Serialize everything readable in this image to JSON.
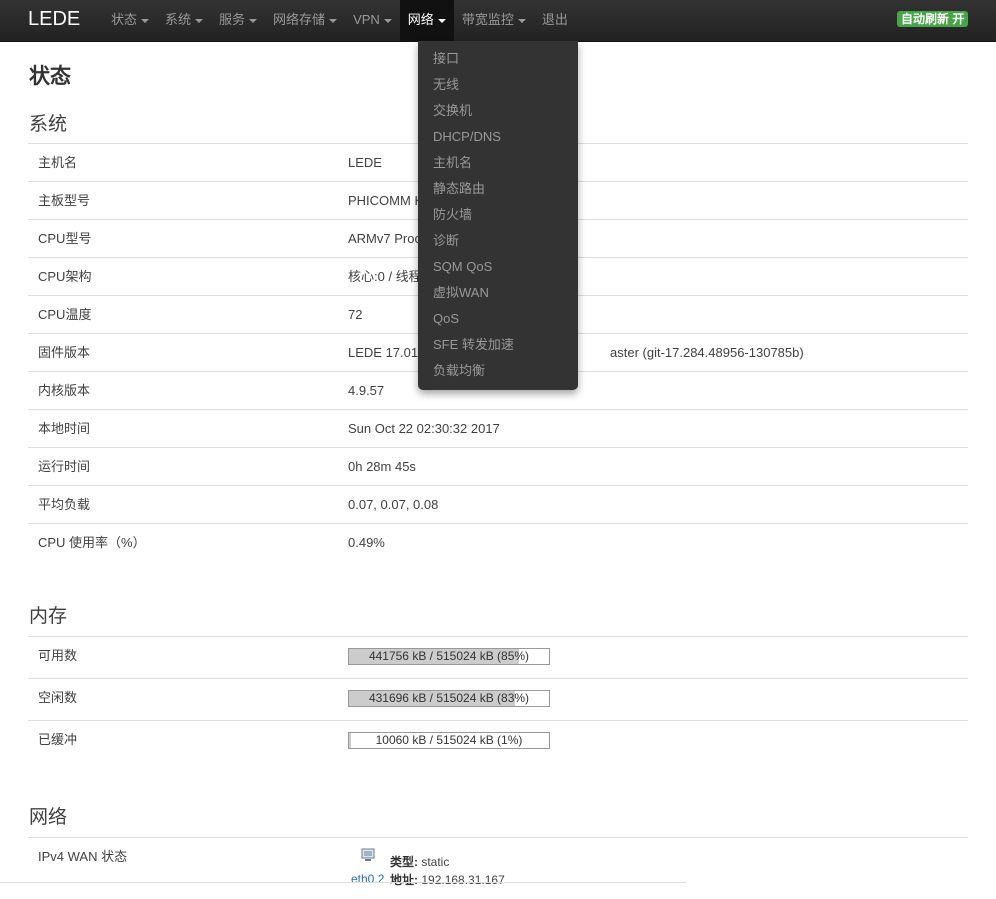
{
  "navbar": {
    "brand": "LEDE",
    "items": [
      {
        "label": "状态",
        "dropdown": true
      },
      {
        "label": "系统",
        "dropdown": true
      },
      {
        "label": "服务",
        "dropdown": true
      },
      {
        "label": "网络存储",
        "dropdown": true
      },
      {
        "label": "VPN",
        "dropdown": true
      },
      {
        "label": "网络",
        "dropdown": true,
        "active": true
      },
      {
        "label": "带宽监控",
        "dropdown": true
      },
      {
        "label": "退出",
        "dropdown": false
      }
    ],
    "auto_refresh": "自动刷新 开",
    "auto_refresh_color": "#46a546"
  },
  "dropdown": {
    "items": [
      "接口",
      "无线",
      "交换机",
      "DHCP/DNS",
      "主机名",
      "静态路由",
      "防火墙",
      "诊断",
      "SQM QoS",
      "虚拟WAN",
      "QoS",
      "SFE 转发加速",
      "负载均衡"
    ]
  },
  "page": {
    "title": "状态"
  },
  "system": {
    "title": "系统",
    "rows": [
      {
        "label": "主机名",
        "value": "LEDE"
      },
      {
        "label": "主板型号",
        "value": "PHICOMM K"
      },
      {
        "label": "CPU型号",
        "value": "ARMv7 Proc"
      },
      {
        "label": "CPU架构",
        "value": "核心:0 / 线程"
      },
      {
        "label": "CPU温度",
        "value": "72"
      },
      {
        "label": "固件版本",
        "value": "LEDE 17.01",
        "value_tail": "aster (git-17.284.48956-130785b)"
      },
      {
        "label": "内核版本",
        "value": "4.9.57"
      },
      {
        "label": "本地时间",
        "value": "Sun Oct 22 02:30:32 2017"
      },
      {
        "label": "运行时间",
        "value": "0h 28m 45s"
      },
      {
        "label": "平均负载",
        "value": "0.07, 0.07, 0.08"
      },
      {
        "label": "CPU 使用率（%）",
        "value": "0.49%"
      }
    ]
  },
  "memory": {
    "title": "内存",
    "rows": [
      {
        "label": "可用数",
        "text": "441756 kB / 515024 kB (85%)",
        "percent": 85
      },
      {
        "label": "空闲数",
        "text": "431696 kB / 515024 kB (83%)",
        "percent": 83
      },
      {
        "label": "已缓冲",
        "text": "10060 kB / 515024 kB (1%)",
        "percent": 1
      }
    ]
  },
  "network": {
    "title": "网络",
    "wan_label": "IPv4 WAN 状态",
    "iface": "eth0.2",
    "type_label": "类型:",
    "type_value": "static",
    "addr_label": "地址:",
    "addr_value": "192.168.31.167"
  }
}
